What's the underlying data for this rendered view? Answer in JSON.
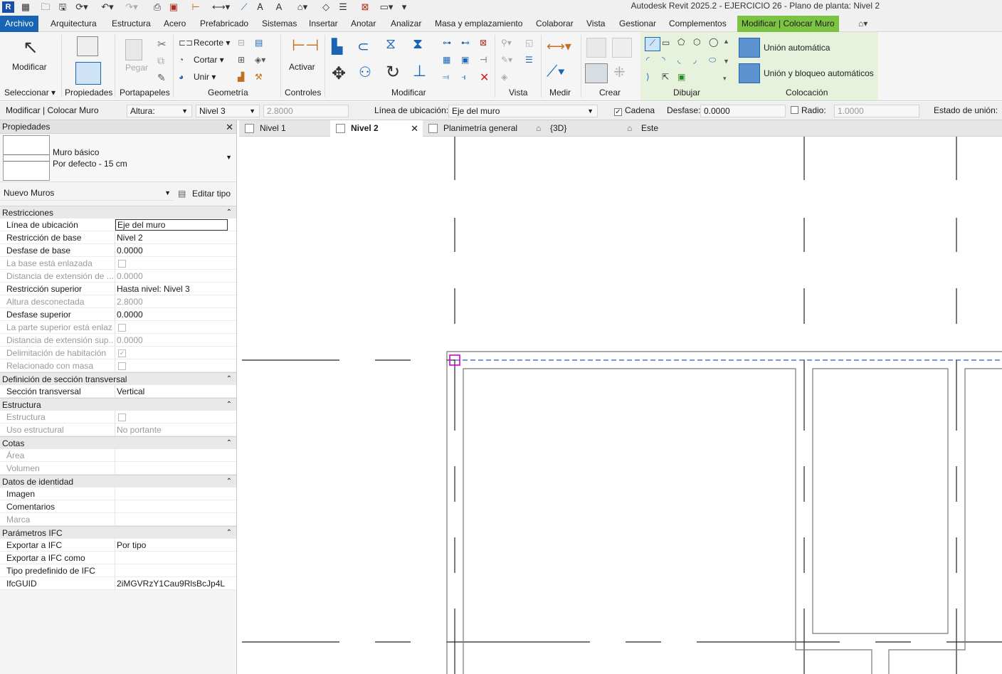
{
  "app": {
    "logo": "R",
    "title": "Autodesk Revit 2025.2 - EJERCICIO 26 - Plano de planta: Nivel 2"
  },
  "menu": {
    "tabs": [
      "Archivo",
      "Arquitectura",
      "Estructura",
      "Acero",
      "Prefabricado",
      "Sistemas",
      "Insertar",
      "Anotar",
      "Analizar",
      "Masa y emplazamiento",
      "Colaborar",
      "Vista",
      "Gestionar",
      "Complementos",
      "Modificar | Colocar Muro"
    ]
  },
  "ribbon": {
    "modificar": "Modificar",
    "seleccionar": "Seleccionar",
    "propiedades": "Propiedades",
    "portapapeles": "Portapapeles",
    "pegar": "Pegar",
    "recorte": "Recorte",
    "cortar": "Cortar",
    "unir": "Unir",
    "geometria": "Geometría",
    "activar": "Activar",
    "controles": "Controles",
    "modificar_panel": "Modificar",
    "vista": "Vista",
    "medir": "Medir",
    "crear": "Crear",
    "dibujar": "Dibujar",
    "colocacion": "Colocación",
    "union_auto": "Unión automática",
    "union_bloqueo": "Unión y bloqueo automáticos"
  },
  "options": {
    "context": "Modificar | Colocar Muro",
    "altura_label": "Altura:",
    "altura_value": "Nivel 3",
    "altura_num": "2.8000",
    "ubicacion_label": "Línea de ubicación:",
    "ubicacion_value": "Eje del muro",
    "cadena": "Cadena",
    "desfase_label": "Desfase:",
    "desfase_value": "0.0000",
    "radio_label": "Radio:",
    "radio_value": "1.0000",
    "estado": "Estado de unión:"
  },
  "properties": {
    "title": "Propiedades",
    "type_family": "Muro básico",
    "type_name": "Por defecto - 15 cm",
    "filter": "Nuevo Muros",
    "edit_type": "Editar tipo",
    "sections": [
      {
        "name": "Restricciones"
      },
      {
        "name": "Definición de sección transversal"
      },
      {
        "name": "Estructura"
      },
      {
        "name": "Cotas"
      },
      {
        "name": "Datos de identidad"
      },
      {
        "name": "Parámetros IFC"
      }
    ],
    "rows": [
      {
        "name": "Línea de ubicación",
        "value": "Eje del muro"
      },
      {
        "name": "Restricción de base",
        "value": "Nivel 2"
      },
      {
        "name": "Desfase de base",
        "value": "0.0000"
      },
      {
        "name": "La base está enlazada",
        "value": ""
      },
      {
        "name": "Distancia de extensión de ...",
        "value": "0.0000"
      },
      {
        "name": "Restricción superior",
        "value": "Hasta nivel: Nivel 3"
      },
      {
        "name": "Altura desconectada",
        "value": "2.8000"
      },
      {
        "name": "Desfase superior",
        "value": "0.0000"
      },
      {
        "name": "La parte superior está enlaz...",
        "value": ""
      },
      {
        "name": "Distancia de extensión sup...",
        "value": "0.0000"
      },
      {
        "name": "Delimitación de habitación",
        "value": ""
      },
      {
        "name": "Relacionado con masa",
        "value": ""
      },
      {
        "name": "Sección transversal",
        "value": "Vertical"
      },
      {
        "name": "Estructura",
        "value": ""
      },
      {
        "name": "Uso estructural",
        "value": "No portante"
      },
      {
        "name": "Área",
        "value": ""
      },
      {
        "name": "Volumen",
        "value": ""
      },
      {
        "name": "Imagen",
        "value": ""
      },
      {
        "name": "Comentarios",
        "value": ""
      },
      {
        "name": "Marca",
        "value": ""
      },
      {
        "name": "Exportar a IFC",
        "value": "Por tipo"
      },
      {
        "name": "Exportar a IFC como",
        "value": ""
      },
      {
        "name": "Tipo predefinido de IFC",
        "value": ""
      },
      {
        "name": "IfcGUID",
        "value": "2iMGVRzY1Cau9RlsBcJp4L"
      }
    ]
  },
  "views": {
    "tabs": [
      "Nivel 1",
      "Nivel 2",
      "Planimetría general",
      "{3D}",
      "Este"
    ]
  }
}
